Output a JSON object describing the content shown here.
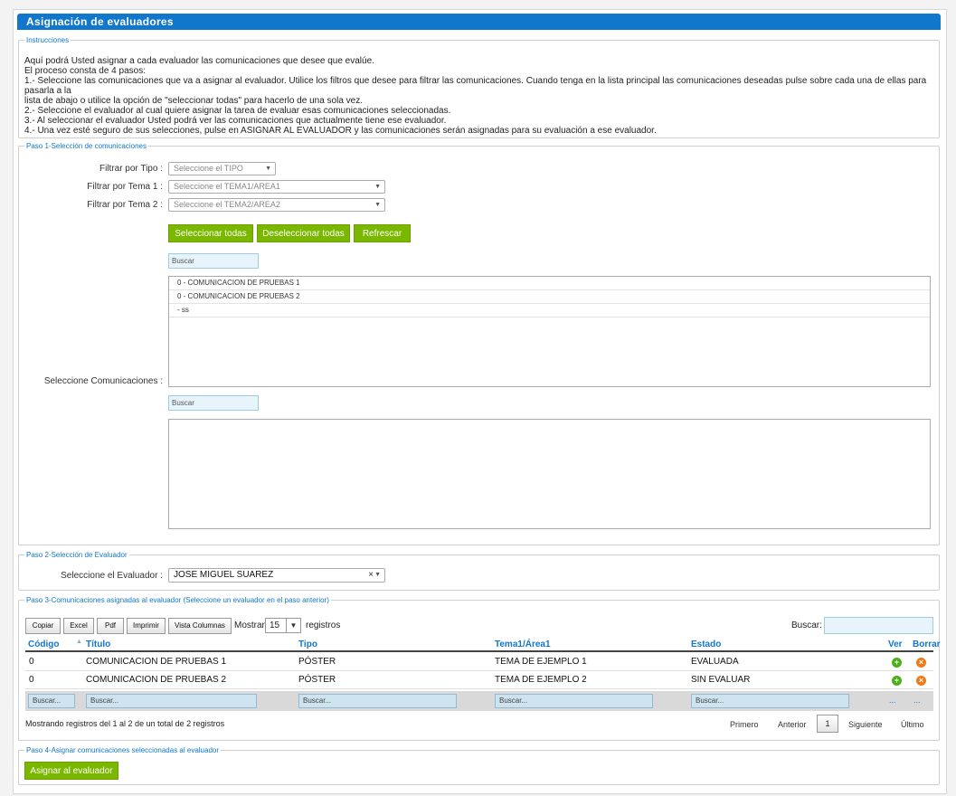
{
  "title": "Asignación de evaluadores",
  "instructions": {
    "legend": "Instrucciones",
    "lines": [
      "Aquí podrá Usted asignar a cada evaluador las comunicaciones que desee que evalúe.",
      "El proceso consta de 4 pasos:",
      "1.- Seleccione las comunicaciones que va a asignar al evaluador. Utilice los filtros que desee para filtrar las comunicaciones. Cuando tenga en la lista principal las comunicaciones deseadas pulse sobre cada una de ellas para pasarla a la",
      "lista de abajo o utilice la opción de \"seleccionar todas\" para hacerlo de una sola vez.",
      "2.- Seleccione el evaluador al cual quiere asignar la tarea de evaluar esas comunicaciones seleccionadas.",
      "3.- Al seleccionar el evaluador Usted podrá ver las comunicaciones que actualmente tiene ese evaluador.",
      "4.- Una vez esté seguro de sus selecciones, pulse en ASIGNAR AL EVALUADOR y las comunicaciones serán asignadas para su evaluación a ese evaluador."
    ]
  },
  "step1": {
    "legend": "Paso 1-Selección de comunicaciones",
    "filter_tipo_label": "Filtrar por Tipo :",
    "filter_tipo_value": "Seleccione el TIPO",
    "filter_tema1_label": "Filtrar por Tema 1 :",
    "filter_tema1_value": "Seleccione el TEMA1/AREA1",
    "filter_tema2_label": "Filtrar por Tema 2 :",
    "filter_tema2_value": "Seleccione el TEMA2/AREA2",
    "btn_select_all": "Seleccionar todas",
    "btn_deselect_all": "Deseleccionar todas",
    "btn_refresh": "Refrescar",
    "search1": "Buscar",
    "list_items": [
      "0 - COMUNICACION DE PRUEBAS 1",
      "0 - COMUNICACION DE PRUEBAS 2",
      "- ss"
    ],
    "select_label": "Seleccione Comunicaciones :",
    "search2": "Buscar"
  },
  "step2": {
    "legend": "Paso 2-Selección de Evaluador",
    "label": "Seleccione el Evaluador :",
    "value": "JOSE MIGUEL SUAREZ",
    "clear": "×"
  },
  "step3": {
    "legend": "Paso 3-Comunicaciones asignadas al evaluador (Seleccione un evaluador en el paso anterior)",
    "toolbar": [
      "Copiar",
      "Excel",
      "Pdf",
      "Imprimir",
      "Vista Columnas"
    ],
    "show_label": "Mostrar",
    "page_size": "15",
    "records_label": "registros",
    "search_label": "Buscar:",
    "columns": [
      "Código",
      "Título",
      "Tipo",
      "Tema1/Área1",
      "Estado",
      "Ver",
      "Borrar"
    ],
    "rows": [
      [
        "0",
        "COMUNICACION DE PRUEBAS 1",
        "PÓSTER",
        "TEMA DE EJEMPLO 1",
        "EVALUADA"
      ],
      [
        "0",
        "COMUNICACION DE PRUEBAS 2",
        "PÓSTER",
        "TEMA DE EJEMPLO 2",
        "SIN EVALUAR"
      ]
    ],
    "col_search": "Buscar...",
    "ellipsis": "...",
    "info": "Mostrando registros del 1 al 2 de un total de 2 registros",
    "pagination": {
      "first": "Primero",
      "prev": "Anterior",
      "current": "1",
      "next": "Siguiente",
      "last": "Último"
    }
  },
  "step4": {
    "legend": "Paso 4-Asignar comunicaciones seleccionadas al evaluador",
    "button": "Asignar al evaluador"
  },
  "colors": {
    "accent": "#1177cc",
    "button": "#7ab800",
    "add_icon": "#4caf1a",
    "delete_icon": "#f07a18"
  }
}
